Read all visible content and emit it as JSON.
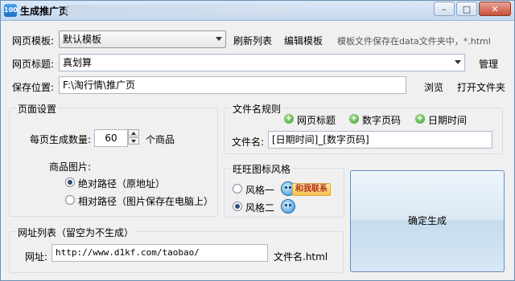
{
  "window": {
    "title": "生成推广页",
    "app_icon_text": "100",
    "buttons": {
      "minimize": "–",
      "maximize": "□",
      "close": "✕"
    }
  },
  "template_row": {
    "label": "网页模板:",
    "selected": "默认模板",
    "refresh_label": "刷新列表",
    "edit_label": "编辑模板",
    "hint": "模板文件保存在data文件夹中，*.html"
  },
  "title_row": {
    "label": "网页标题:",
    "value": "真划算",
    "manage_label": "管理"
  },
  "save_row": {
    "label": "保存位置:",
    "value": "F:\\淘行情\\推广页",
    "browse_label": "浏览",
    "open_folder_label": "打开文件夹"
  },
  "page_settings": {
    "title": "页面设置",
    "per_page_label": "每页生成数量:",
    "per_page_value": "60",
    "per_page_unit": "个商品",
    "image_label": "商品图片:",
    "options": [
      {
        "label": "绝对路径（原地址）",
        "selected": true
      },
      {
        "label": "相对路径（图片保存在电脑上）",
        "selected": false
      }
    ]
  },
  "filename_rules": {
    "title": "文件名规则",
    "tokens": [
      "网页标题",
      "数字页码",
      "日期时间"
    ],
    "filename_label": "文件名:",
    "filename_value": "[日期时间]_[数字页码]"
  },
  "wangwang_style": {
    "title": "旺旺图标风格",
    "options": [
      {
        "label": "风格一",
        "selected": false,
        "badge": "和我联系"
      },
      {
        "label": "风格二",
        "selected": true
      }
    ]
  },
  "generate_button": {
    "label": "确定生成"
  },
  "url_list": {
    "title": "网址列表（留空为不生成）",
    "label": "网址:",
    "value": "http://www.d1kf.com/taobao/",
    "suffix": "文件名.html"
  }
}
